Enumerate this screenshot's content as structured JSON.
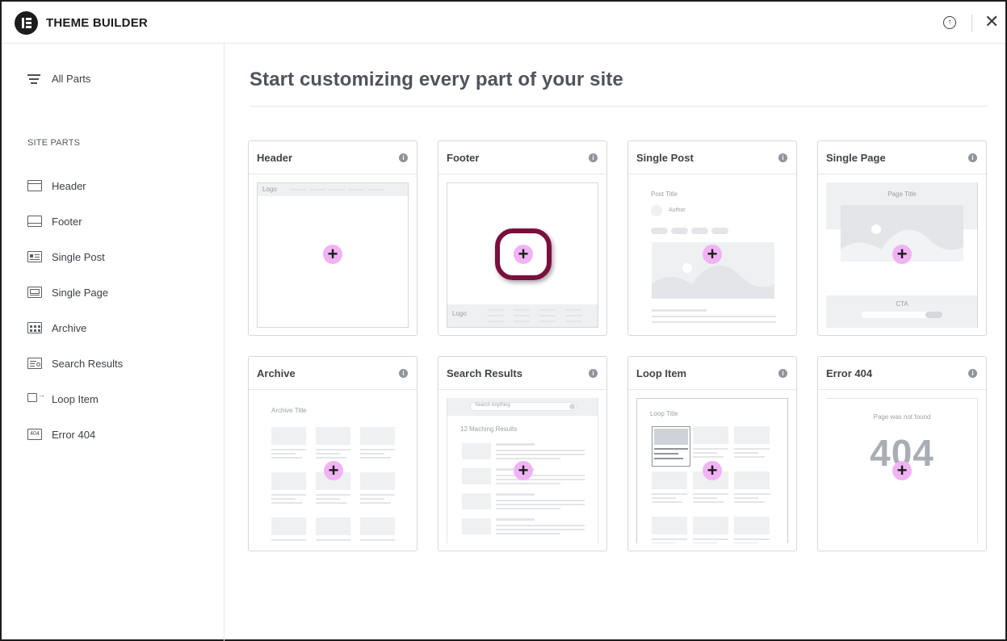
{
  "app": {
    "title": "THEME BUILDER"
  },
  "sidebar": {
    "all_parts": "All Parts",
    "section_title": "SITE PARTS",
    "items": [
      {
        "label": "Header",
        "icon": "header-layout-icon"
      },
      {
        "label": "Footer",
        "icon": "footer-layout-icon"
      },
      {
        "label": "Single Post",
        "icon": "single-post-icon"
      },
      {
        "label": "Single Page",
        "icon": "single-page-icon"
      },
      {
        "label": "Archive",
        "icon": "archive-grid-icon"
      },
      {
        "label": "Search Results",
        "icon": "search-results-icon"
      },
      {
        "label": "Loop Item",
        "icon": "loop-item-icon"
      },
      {
        "label": "Error 404",
        "icon": "error-404-icon"
      }
    ]
  },
  "main": {
    "title": "Start customizing every part of your site",
    "cards": [
      {
        "title": "Header",
        "preview": {
          "logo": "Logo"
        }
      },
      {
        "title": "Footer",
        "preview": {
          "logo": "Logo"
        }
      },
      {
        "title": "Single Post",
        "preview": {
          "post_title": "Post Title",
          "author": "Author"
        }
      },
      {
        "title": "Single Page",
        "preview": {
          "page_title": "Page Title",
          "cta": "CTA"
        }
      },
      {
        "title": "Archive",
        "preview": {
          "archive_title": "Archive Title"
        }
      },
      {
        "title": "Search Results",
        "preview": {
          "search_placeholder": "Search Anything",
          "results": "12 Maching Results"
        }
      },
      {
        "title": "Loop Item",
        "preview": {
          "loop_title": "Loop Title"
        }
      },
      {
        "title": "Error 404",
        "preview": {
          "not_found": "Page was not found",
          "code": "404"
        }
      }
    ],
    "add_symbol": "+"
  },
  "colors": {
    "accent_plus": "#f1b3f4",
    "highlight": "#7a0f3d"
  }
}
